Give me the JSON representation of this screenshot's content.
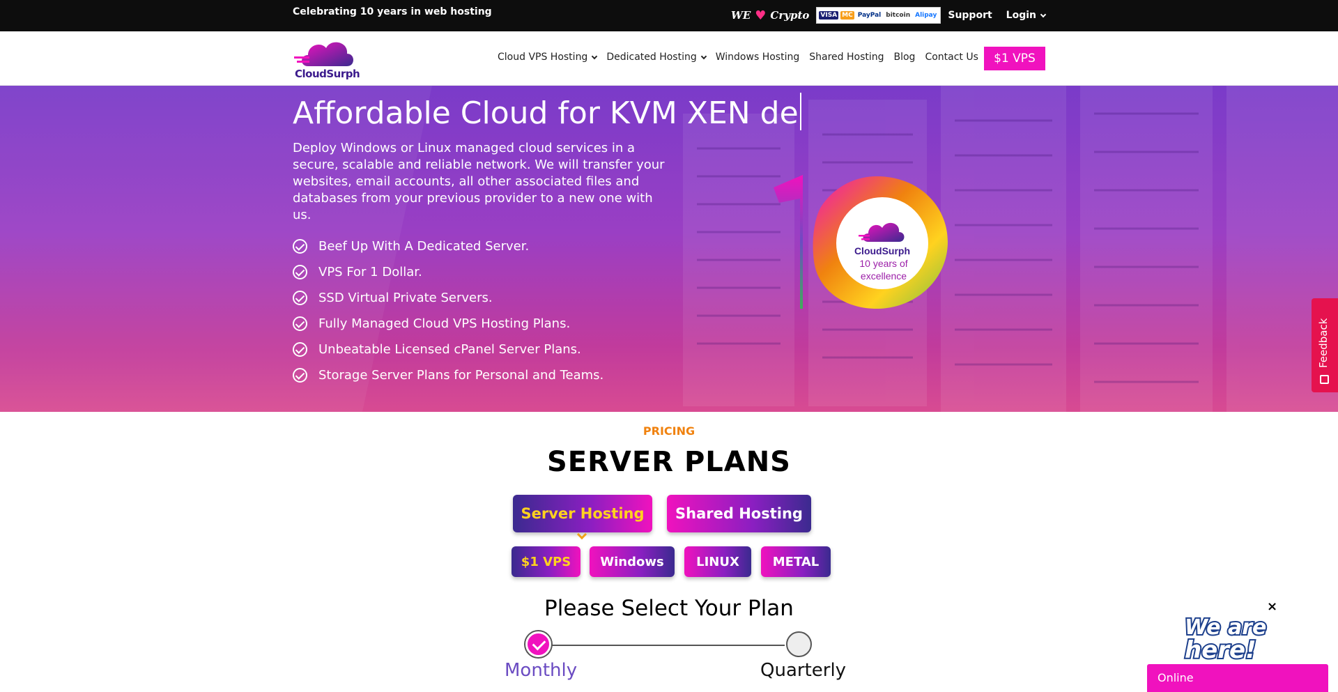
{
  "topbar": {
    "celebrate": "Celebrating 10 years in web hosting",
    "we": "WE",
    "crypto": "Crypto",
    "payments": [
      "VISA",
      "MC",
      "PayPal",
      "bitcoin",
      "Alipay"
    ],
    "support": "Support",
    "login": "Login"
  },
  "nav": {
    "logo_text": "CloudSurph",
    "links": [
      "Cloud VPS Hosting",
      "Dedicated Hosting",
      "Windows Hosting",
      "Shared Hosting",
      "Blog",
      "Contact Us"
    ],
    "cta": "$1 VPS"
  },
  "hero": {
    "title": "Affordable Cloud for KVM XEN de",
    "description": "Deploy Windows or Linux managed cloud services in a secure, scalable and reliable network. We will transfer your websites, email accounts, all other associated files and databases from your previous provider to a new one with us.",
    "features": [
      "Beef Up With A Dedicated Server.",
      "VPS For 1 Dollar.",
      "SSD Virtual Private Servers.",
      "Fully Managed Cloud VPS Hosting Plans.",
      "Unbeatable Licensed cPanel Server Plans.",
      "Storage Server Plans for Personal and Teams."
    ],
    "badge": {
      "brand": "CloudSurph",
      "line1": "10 years of",
      "line2": "excellence"
    }
  },
  "feedback": {
    "label": "Feedback"
  },
  "pricing": {
    "eyebrow": "PRICING",
    "title": "SERVER PLANS",
    "tabs": [
      "Server Hosting",
      "Shared Hosting"
    ],
    "active_tab": 0,
    "subtabs": [
      "$1 VPS",
      "Windows",
      "LINUX",
      "METAL"
    ],
    "active_subtab": 0,
    "select_title": "Please Select Your Plan",
    "periods": [
      "Monthly",
      "Quarterly"
    ],
    "selected_period": 0
  },
  "chat": {
    "close": "×",
    "banner": "We are here!",
    "status": "Online"
  },
  "colors": {
    "accent": "#f012be",
    "orange": "#f0820f",
    "gold": "#ffd21f",
    "purple": "#3b2a8f"
  }
}
